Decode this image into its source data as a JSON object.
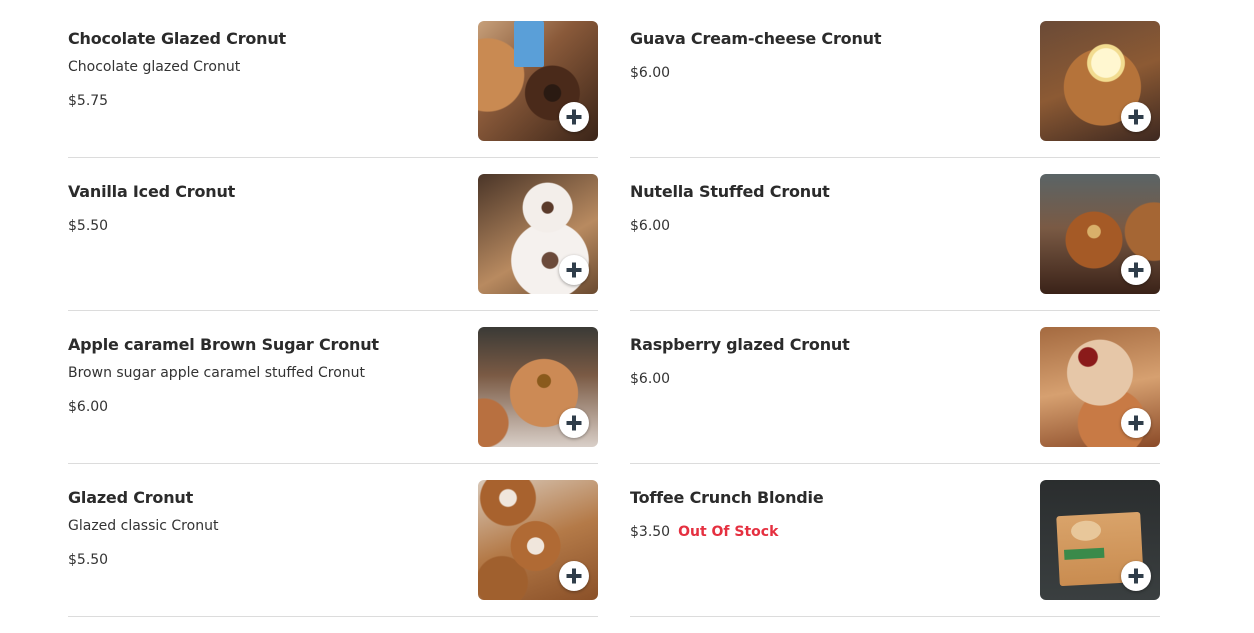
{
  "add_icon": "plus-icon",
  "colors": {
    "accent_text": "#2b2b2b",
    "out_of_stock": "#e53040",
    "add_button_icon": "#2f3d4a",
    "divider": "#dcdcdc"
  },
  "items": [
    {
      "name": "Chocolate Glazed Cronut",
      "description": "Chocolate glazed Cronut",
      "price": "$5.75",
      "stock": "",
      "image": "chocolate-glazed-cronut-image"
    },
    {
      "name": "Guava Cream-cheese Cronut",
      "description": "",
      "price": "$6.00",
      "stock": "",
      "image": "guava-cream-cheese-cronut-image"
    },
    {
      "name": "Vanilla Iced Cronut",
      "description": "",
      "price": "$5.50",
      "stock": "",
      "image": "vanilla-iced-cronut-image"
    },
    {
      "name": "Nutella Stuffed Cronut",
      "description": "",
      "price": "$6.00",
      "stock": "",
      "image": "nutella-stuffed-cronut-image"
    },
    {
      "name": "Apple caramel Brown Sugar Cronut",
      "description": "Brown sugar apple caramel stuffed Cronut",
      "price": "$6.00",
      "stock": "",
      "image": "apple-caramel-cronut-image"
    },
    {
      "name": "Raspberry glazed Cronut",
      "description": "",
      "price": "$6.00",
      "stock": "",
      "image": "raspberry-glazed-cronut-image"
    },
    {
      "name": "Glazed Cronut",
      "description": "Glazed classic Cronut",
      "price": "$5.50",
      "stock": "",
      "image": "glazed-cronut-image"
    },
    {
      "name": "Toffee Crunch Blondie",
      "description": "",
      "price": "$3.50",
      "stock": "Out Of Stock",
      "image": "toffee-crunch-blondie-image"
    }
  ]
}
